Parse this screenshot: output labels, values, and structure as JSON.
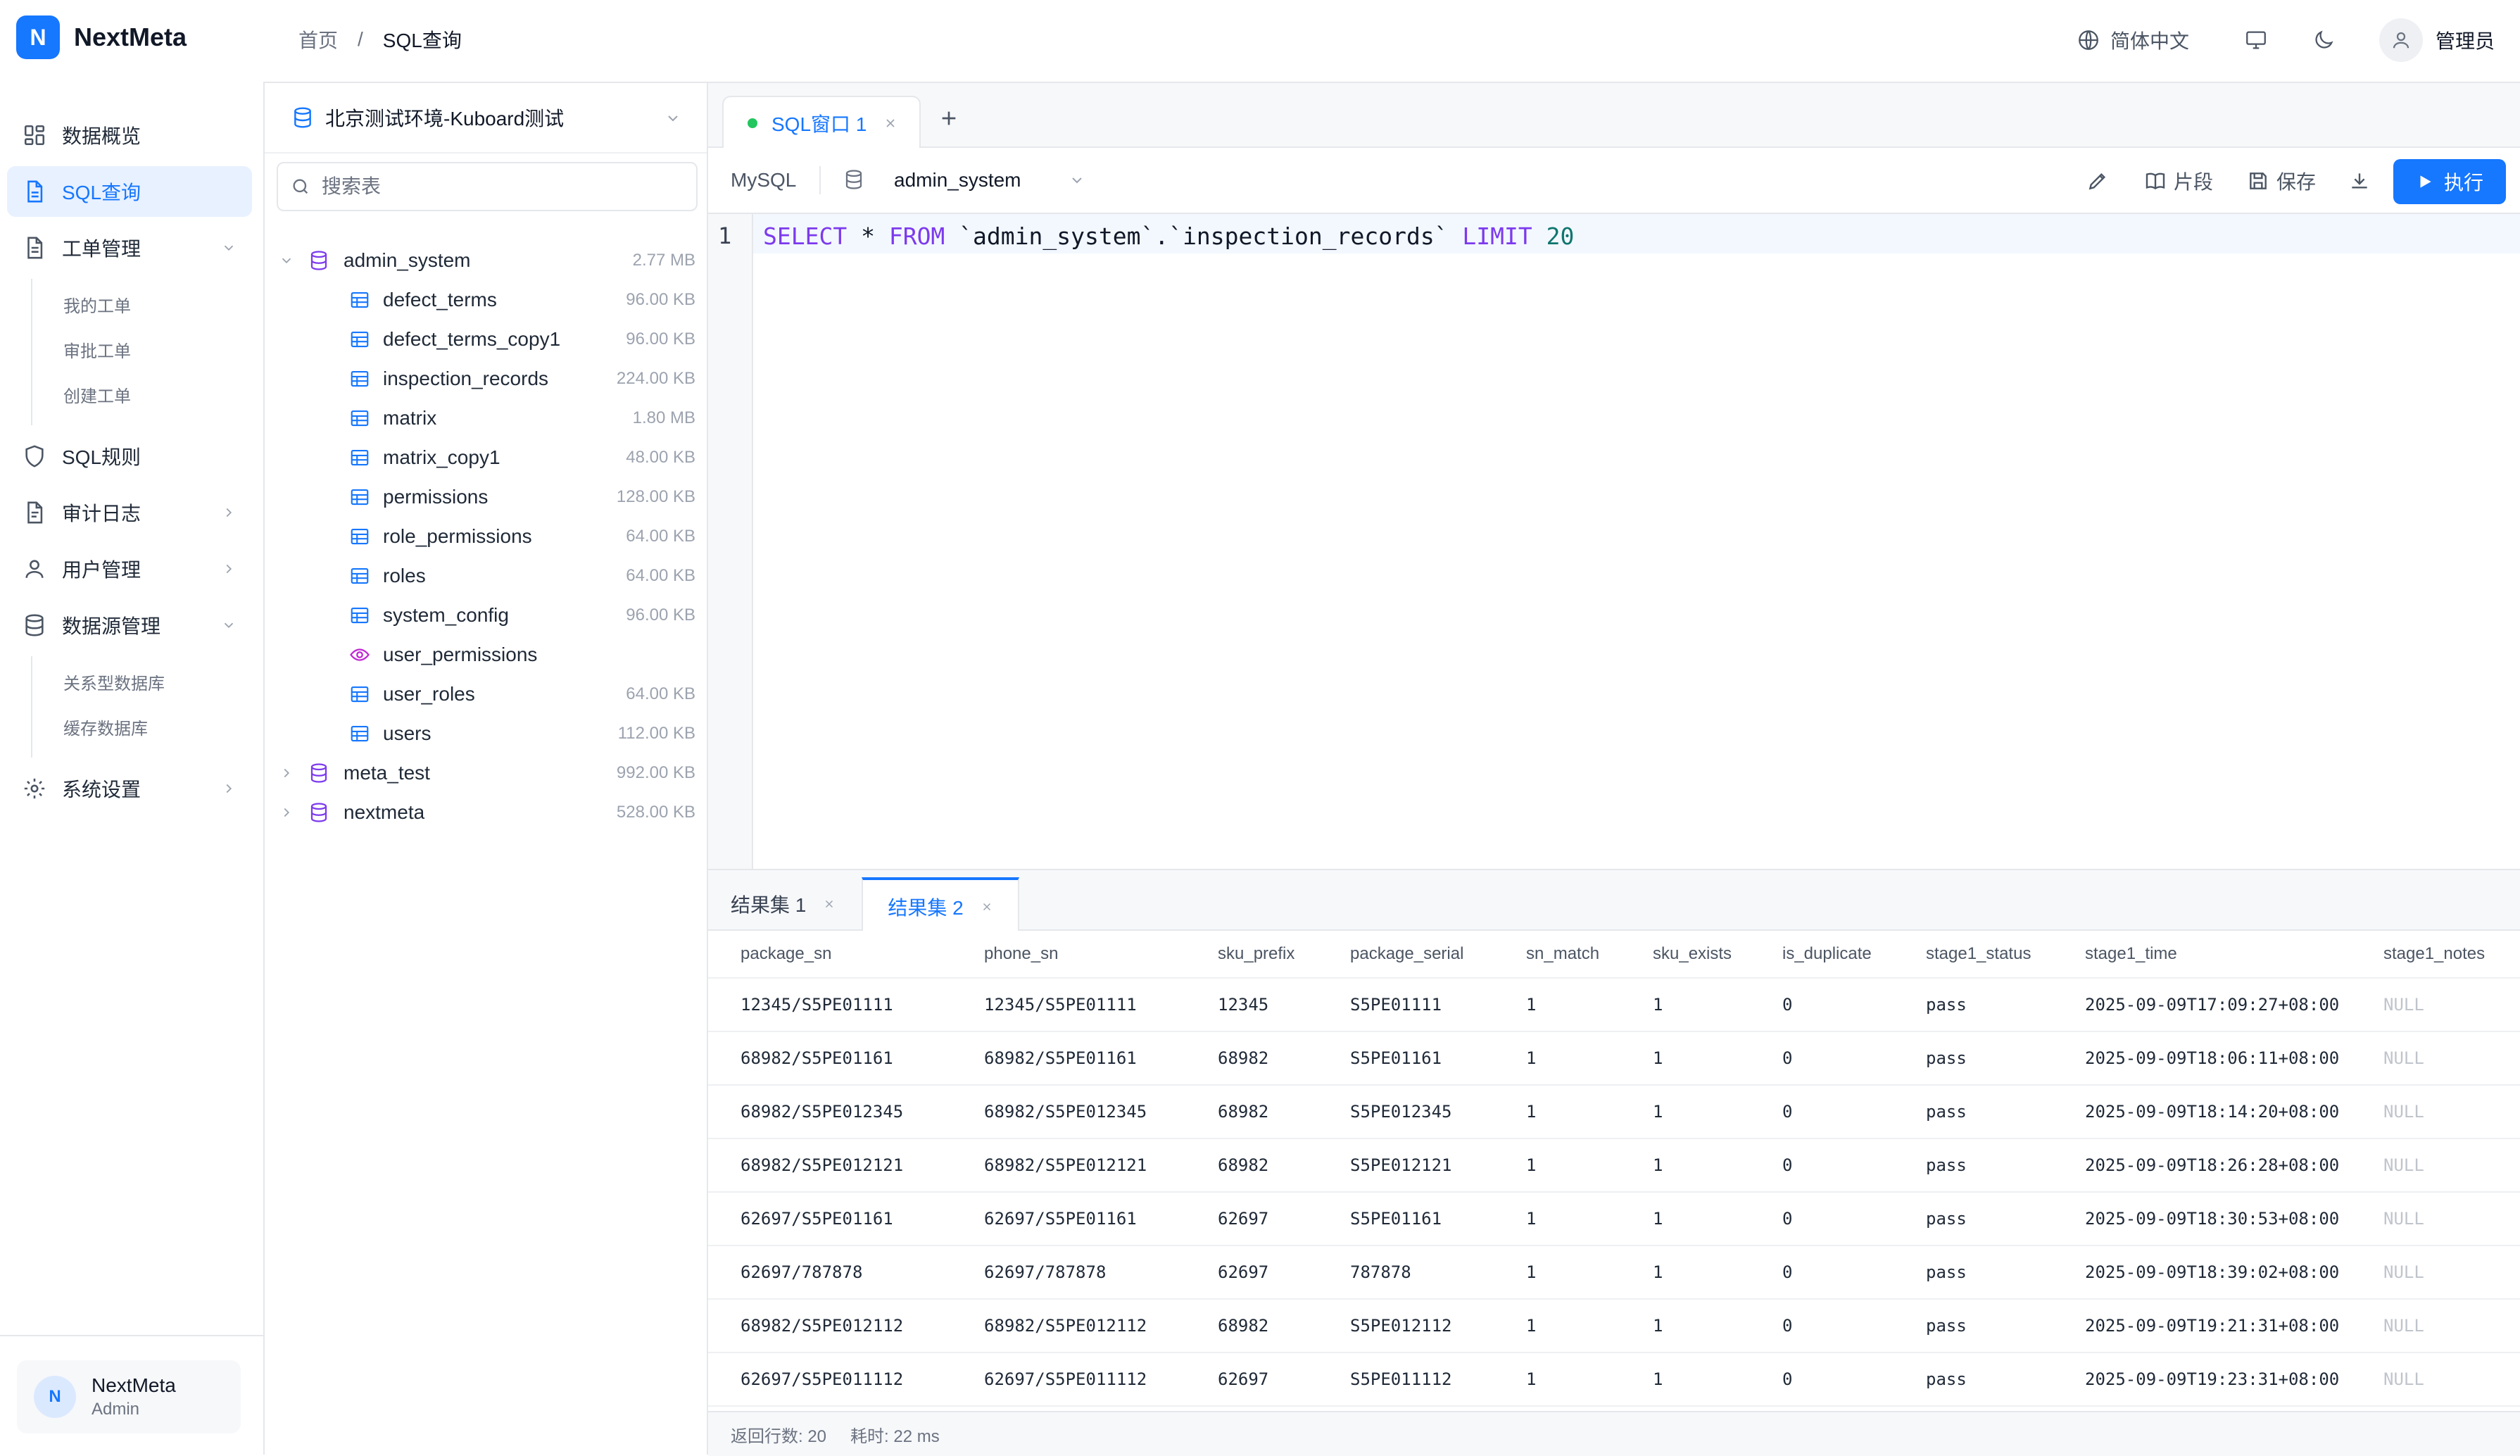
{
  "app": {
    "logo_letter": "N",
    "name": "NextMeta"
  },
  "nav": {
    "items": [
      {
        "label": "数据概览"
      },
      {
        "label": "SQL查询"
      },
      {
        "label": "工单管理"
      },
      {
        "label": "SQL规则"
      },
      {
        "label": "审计日志"
      },
      {
        "label": "用户管理"
      },
      {
        "label": "数据源管理"
      },
      {
        "label": "系统设置"
      }
    ],
    "workorder_sub": [
      "我的工单",
      "审批工单",
      "创建工单"
    ],
    "datasource_sub": [
      "关系型数据库",
      "缓存数据库"
    ]
  },
  "user_card": {
    "initial": "N",
    "name": "NextMeta",
    "role": "Admin"
  },
  "header": {
    "breadcrumb_home": "首页",
    "breadcrumb_sep": "/",
    "breadcrumb_current": "SQL查询",
    "language": "简体中文",
    "user": "管理员"
  },
  "datasource": {
    "selected": "北京测试环境-Kuboard测试"
  },
  "search": {
    "placeholder": "搜索表",
    "value": ""
  },
  "tree": {
    "databases": [
      {
        "name": "admin_system",
        "size": "2.77 MB",
        "expanded": true
      },
      {
        "name": "meta_test",
        "size": "992.00 KB",
        "expanded": false
      },
      {
        "name": "nextmeta",
        "size": "528.00 KB",
        "expanded": false
      }
    ],
    "tables": [
      {
        "name": "defect_terms",
        "size": "96.00 KB",
        "type": "table"
      },
      {
        "name": "defect_terms_copy1",
        "size": "96.00 KB",
        "type": "table"
      },
      {
        "name": "inspection_records",
        "size": "224.00 KB",
        "type": "table"
      },
      {
        "name": "matrix",
        "size": "1.80 MB",
        "type": "table"
      },
      {
        "name": "matrix_copy1",
        "size": "48.00 KB",
        "type": "table"
      },
      {
        "name": "permissions",
        "size": "128.00 KB",
        "type": "table"
      },
      {
        "name": "role_permissions",
        "size": "64.00 KB",
        "type": "table"
      },
      {
        "name": "roles",
        "size": "64.00 KB",
        "type": "table"
      },
      {
        "name": "system_config",
        "size": "96.00 KB",
        "type": "table"
      },
      {
        "name": "user_permissions",
        "size": "",
        "type": "view"
      },
      {
        "name": "user_roles",
        "size": "64.00 KB",
        "type": "table"
      },
      {
        "name": "users",
        "size": "112.00 KB",
        "type": "table"
      }
    ]
  },
  "editor_tab": {
    "label": "SQL窗口 1"
  },
  "toolbar": {
    "engine": "MySQL",
    "schema": "admin_system",
    "snippet": "片段",
    "save": "保存",
    "run": "执行"
  },
  "editor": {
    "line_number": "1",
    "sql": {
      "kw1": "SELECT",
      "star": " * ",
      "kw2": "FROM",
      "target": " `admin_system`.`inspection_records` ",
      "kw3": "LIMIT",
      "space": " ",
      "limit": "20"
    }
  },
  "result_tabs": [
    "结果集 1",
    "结果集 2"
  ],
  "results": {
    "columns": [
      "package_sn",
      "phone_sn",
      "sku_prefix",
      "package_serial",
      "sn_match",
      "sku_exists",
      "is_duplicate",
      "stage1_status",
      "stage1_time",
      "stage1_notes"
    ],
    "rows": [
      [
        "12345/S5PE01111",
        "12345/S5PE01111",
        "12345",
        "S5PE01111",
        "1",
        "1",
        "0",
        "pass",
        "2025-09-09T17:09:27+08:00",
        "NULL"
      ],
      [
        "68982/S5PE01161",
        "68982/S5PE01161",
        "68982",
        "S5PE01161",
        "1",
        "1",
        "0",
        "pass",
        "2025-09-09T18:06:11+08:00",
        "NULL"
      ],
      [
        "68982/S5PE012345",
        "68982/S5PE012345",
        "68982",
        "S5PE012345",
        "1",
        "1",
        "0",
        "pass",
        "2025-09-09T18:14:20+08:00",
        "NULL"
      ],
      [
        "68982/S5PE012121",
        "68982/S5PE012121",
        "68982",
        "S5PE012121",
        "1",
        "1",
        "0",
        "pass",
        "2025-09-09T18:26:28+08:00",
        "NULL"
      ],
      [
        "62697/S5PE01161",
        "62697/S5PE01161",
        "62697",
        "S5PE01161",
        "1",
        "1",
        "0",
        "pass",
        "2025-09-09T18:30:53+08:00",
        "NULL"
      ],
      [
        "62697/787878",
        "62697/787878",
        "62697",
        "787878",
        "1",
        "1",
        "0",
        "pass",
        "2025-09-09T18:39:02+08:00",
        "NULL"
      ],
      [
        "68982/S5PE012112",
        "68982/S5PE012112",
        "68982",
        "S5PE012112",
        "1",
        "1",
        "0",
        "pass",
        "2025-09-09T19:21:31+08:00",
        "NULL"
      ],
      [
        "62697/S5PE011112",
        "62697/S5PE011112",
        "62697",
        "S5PE011112",
        "1",
        "1",
        "0",
        "pass",
        "2025-09-09T19:23:31+08:00",
        "NULL"
      ]
    ]
  },
  "status": {
    "rows": "返回行数: 20",
    "time": "耗时: 22 ms"
  },
  "colors": {
    "accent": "#1677ff",
    "keyword": "#7c3aed",
    "number": "#0f766e",
    "success_dot": "#22c55e"
  }
}
